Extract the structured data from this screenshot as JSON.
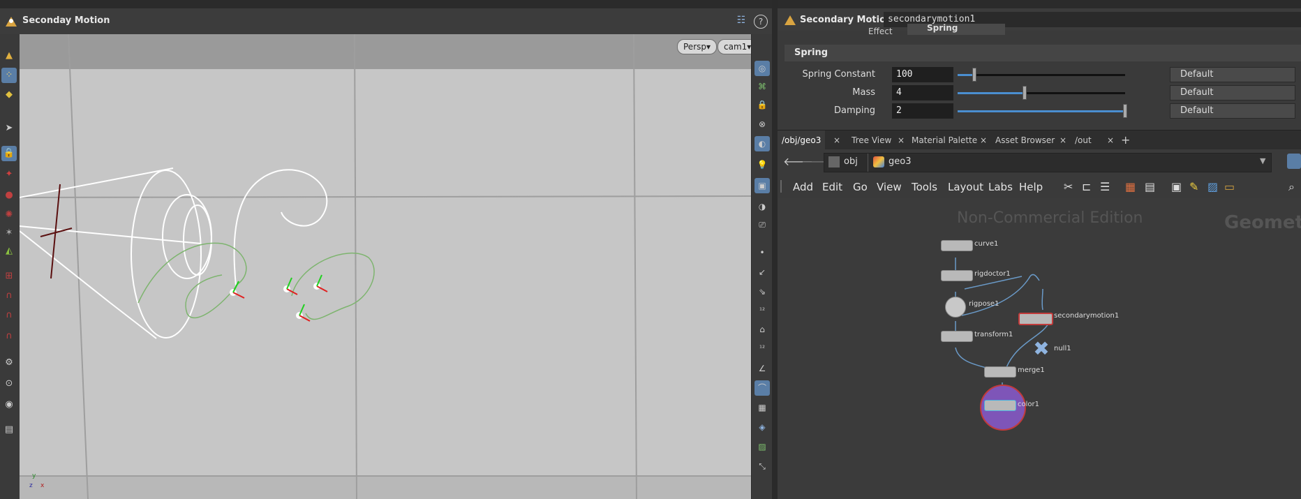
{
  "viewport": {
    "title": "Seconday Motion",
    "view_mode": "Persp▾",
    "camera": "cam1▾",
    "axis_labels": {
      "y": "y",
      "z": "z",
      "x": "x"
    }
  },
  "params": {
    "op_type": "Secondary Motion",
    "node_name": "secondarymotion1",
    "effect_label": "Effect",
    "effect_value": "Spring",
    "folder": "Spring",
    "rows": [
      {
        "label": "Spring Constant",
        "value": "100",
        "default": "Default",
        "fraction": 0.1
      },
      {
        "label": "Mass",
        "value": "4",
        "default": "Default",
        "fraction": 0.4
      },
      {
        "label": "Damping",
        "value": "2",
        "default": "Default",
        "fraction": 1.0
      }
    ]
  },
  "tabs": [
    {
      "label": "/obj/geo3",
      "close": "×"
    },
    {
      "label": "Tree View",
      "close": "×"
    },
    {
      "label": "Material Palette",
      "close": "×"
    },
    {
      "label": "Asset Browser",
      "close": "×"
    },
    {
      "label": "/out",
      "close": "×"
    }
  ],
  "tab_add": "+",
  "path": {
    "segments": [
      "obj",
      "geo3"
    ]
  },
  "menu": [
    "Add",
    "Edit",
    "Go",
    "View",
    "Tools",
    "Layout",
    "Labs",
    "Help"
  ],
  "network": {
    "watermark": "Non-Commercial Edition",
    "context_label": "Geomet",
    "nodes": [
      "curve1",
      "rigdoctor1",
      "rigpose1",
      "secondarymotion1",
      "transform1",
      "null1",
      "merge1",
      "color1"
    ]
  },
  "colors": {
    "accent": "#5a7ea6",
    "selected_node": "#c23b3b",
    "display_flag": "#7e55b8"
  }
}
